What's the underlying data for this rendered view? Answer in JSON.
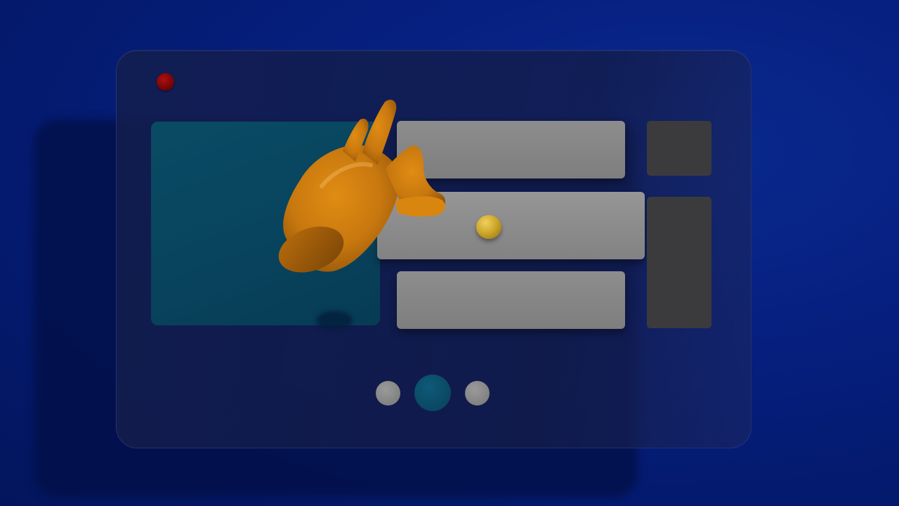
{
  "scene": {
    "description_label": "",
    "colors": {
      "background": "#041a6e",
      "window": "#141e4e",
      "media_panel": "#08435d",
      "row_bar": "#868686",
      "side_block": "#3b3b3d",
      "window_dot": "#8a0808",
      "drag_ball": "#caa426",
      "hand": "#c8780e",
      "pager_inactive": "#8a8a8a",
      "pager_active": "#0a4b64"
    }
  },
  "icons": {
    "window_dot": "red-dot-icon",
    "hand": "hand-pinch-icon",
    "ball": "ball-icon"
  },
  "pager": {
    "count": 3,
    "active_index": 1
  }
}
